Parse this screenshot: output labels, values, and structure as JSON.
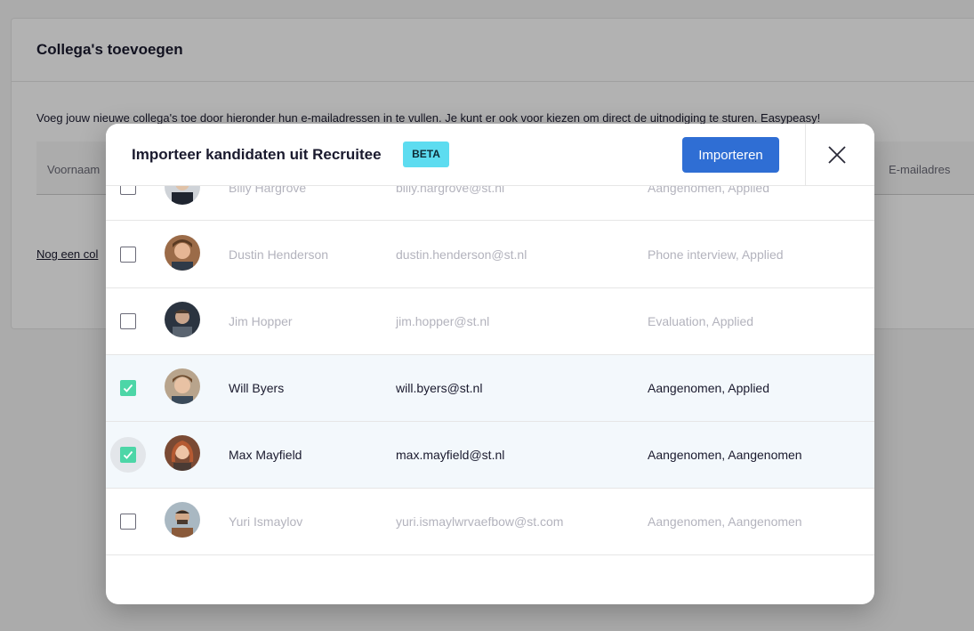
{
  "background": {
    "title": "Collega's toevoegen",
    "description": "Voeg jouw nieuwe collega's toe door hieronder hun e-mailadressen in te vullen. Je kunt er ook voor kiezen om direct de uitnodiging te sturen. Easypeasy!",
    "col_first": "Voornaam",
    "col_email": "E-mailadres",
    "add_link": "Nog een col"
  },
  "modal": {
    "title": "Importeer kandidaten uit Recruitee",
    "badge": "BETA",
    "import_label": "Importeren",
    "close_icon": "close-icon"
  },
  "candidates": [
    {
      "name": "Billy Hargrove",
      "email": "billy.hargrove@st.nl",
      "status": "Aangenomen, Applied",
      "checked": false
    },
    {
      "name": "Dustin Henderson",
      "email": "dustin.henderson@st.nl",
      "status": "Phone interview, Applied",
      "checked": false
    },
    {
      "name": "Jim Hopper",
      "email": "jim.hopper@st.nl",
      "status": "Evaluation, Applied",
      "checked": false
    },
    {
      "name": "Will Byers",
      "email": "will.byers@st.nl",
      "status": "Aangenomen, Applied",
      "checked": true
    },
    {
      "name": "Max Mayfield",
      "email": "max.mayfield@st.nl",
      "status": "Aangenomen, Aangenomen",
      "checked": true
    },
    {
      "name": "Yuri Ismaylov",
      "email": "yuri.ismaylwrvaefbow@st.com",
      "status": "Aangenomen, Aangenomen",
      "checked": false
    }
  ],
  "colors": {
    "primary": "#2f6ed4",
    "badge": "#5ddcf0",
    "check": "#4dd6a7",
    "selected_row": "#f3f8fc"
  }
}
